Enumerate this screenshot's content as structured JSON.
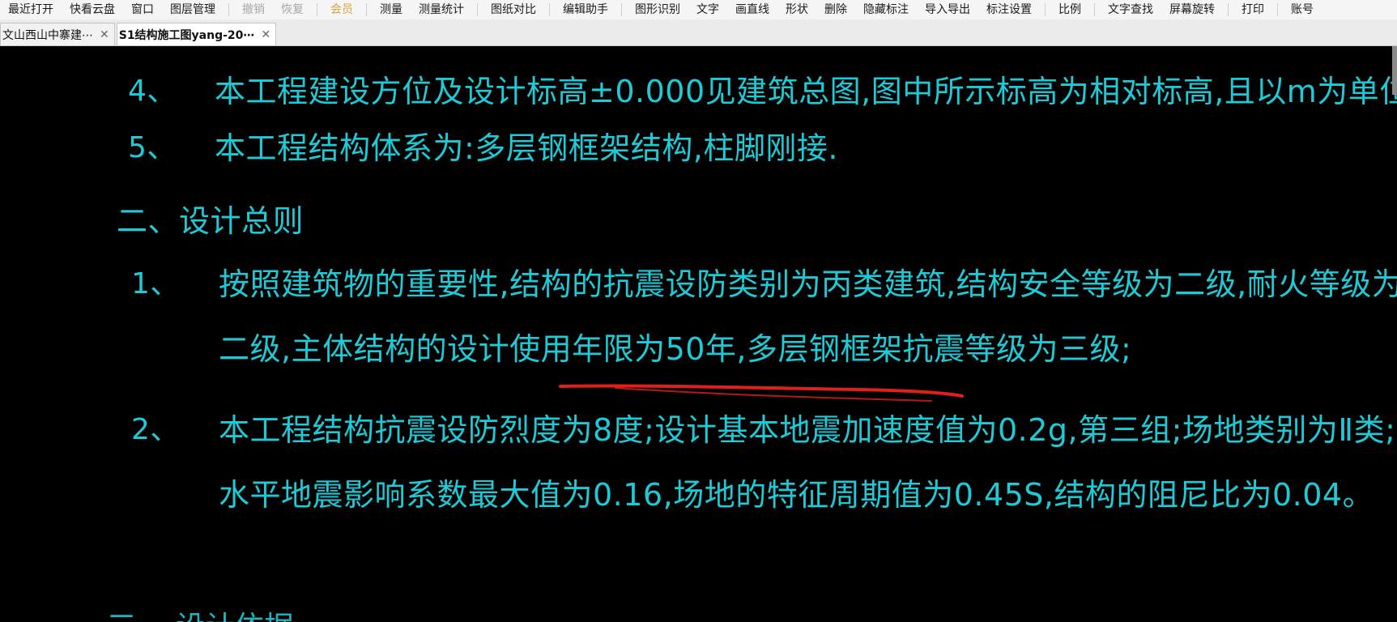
{
  "toolbar": {
    "items": [
      {
        "label": "最近打开",
        "state": "normal"
      },
      {
        "label": "快看云盘",
        "state": "normal"
      },
      {
        "label": "窗口",
        "state": "normal"
      },
      {
        "label": "图层管理",
        "state": "normal"
      },
      {
        "label": "撤销",
        "state": "disabled"
      },
      {
        "label": "恢复",
        "state": "disabled"
      },
      {
        "label": "会员",
        "state": "highlight"
      },
      {
        "label": "测量",
        "state": "normal"
      },
      {
        "label": "测量统计",
        "state": "normal"
      },
      {
        "label": "图纸对比",
        "state": "normal"
      },
      {
        "label": "编辑助手",
        "state": "normal"
      },
      {
        "label": "图形识别",
        "state": "normal"
      },
      {
        "label": "文字",
        "state": "normal"
      },
      {
        "label": "画直线",
        "state": "normal"
      },
      {
        "label": "形状",
        "state": "normal"
      },
      {
        "label": "删除",
        "state": "normal"
      },
      {
        "label": "隐藏标注",
        "state": "normal"
      },
      {
        "label": "导入导出",
        "state": "normal"
      },
      {
        "label": "标注设置",
        "state": "normal"
      },
      {
        "label": "比例",
        "state": "normal"
      },
      {
        "label": "文字查找",
        "state": "normal"
      },
      {
        "label": "屏幕旋转",
        "state": "normal"
      },
      {
        "label": "打印",
        "state": "normal"
      },
      {
        "label": "账号",
        "state": "normal"
      }
    ]
  },
  "tabs": [
    {
      "label": "文山西山中寨建⋯",
      "close": "✕",
      "active": false
    },
    {
      "label": "S1结构施工图yang-20⋯",
      "close": "✕",
      "active": true
    }
  ],
  "drawing": {
    "line4_num": "4、",
    "line4_text": "本工程建设方位及设计标高±0.000见建筑总图,图中所示标高为相对标高,且以m为单位,其余均以mm为单位,",
    "line5_num": "5、",
    "line5_text": "本工程结构体系为:多层钢框架结构,柱脚刚接.",
    "section2_title": "二、设计总则",
    "item1_num": "1、",
    "item1_text_a": "按照建筑物的重要性,结构的抗震设防类别为丙类建筑,结构安全等级为二级,耐火等级为",
    "item1_text_b": "二级,主体结构的设计使用年限为50年,多层钢框架抗震等级为三级;",
    "item2_num": "2、",
    "item2_text_a": "本工程结构抗震设防烈度为8度;设计基本地震加速度值为0.2g,第三组;场地类别为Ⅱ类;",
    "item2_text_b": "水平地震影响系数最大值为0.16,场地的特征周期值为0.45S,结构的阻尼比为0.04。",
    "bottom_partial": "三、  设计依据"
  },
  "colors": {
    "cad_text": "#1ecad6",
    "annotation": "#e0201a",
    "background": "#000000"
  }
}
